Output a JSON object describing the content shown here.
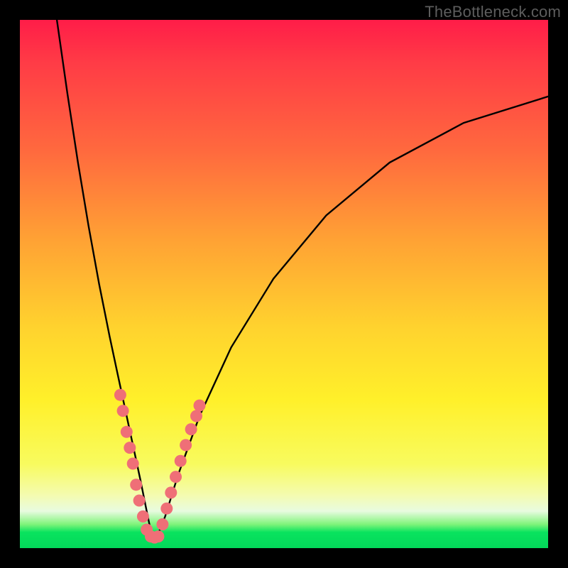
{
  "watermark": "TheBottleneck.com",
  "chart_data": {
    "type": "line",
    "title": "",
    "xlabel": "",
    "ylabel": "",
    "xlim": [
      0,
      100
    ],
    "ylim": [
      0,
      100
    ],
    "series": [
      {
        "name": "curve",
        "x": [
          7,
          9,
          11,
          13,
          15,
          17,
          18.5,
          20,
          21.5,
          22.8,
          24,
          25,
          26,
          27.5,
          30,
          34,
          40,
          48,
          58,
          70,
          84,
          100
        ],
        "y": [
          100,
          86,
          73,
          61,
          50,
          40,
          33,
          26,
          19,
          13,
          7,
          2.2,
          2.2,
          6,
          14,
          25,
          38,
          51,
          63,
          73,
          80.5,
          85.5
        ]
      }
    ],
    "markers": [
      {
        "cluster": "left-upper",
        "points": [
          {
            "x": 19.0,
            "y": 29
          },
          {
            "x": 19.5,
            "y": 26
          },
          {
            "x": 20.2,
            "y": 22
          },
          {
            "x": 20.8,
            "y": 19
          },
          {
            "x": 21.4,
            "y": 16
          }
        ]
      },
      {
        "cluster": "left-lower",
        "points": [
          {
            "x": 22.0,
            "y": 12
          },
          {
            "x": 22.6,
            "y": 9
          },
          {
            "x": 23.3,
            "y": 6
          },
          {
            "x": 24.0,
            "y": 3.5
          }
        ]
      },
      {
        "cluster": "trough",
        "points": [
          {
            "x": 24.8,
            "y": 2.2
          },
          {
            "x": 25.5,
            "y": 2.0
          },
          {
            "x": 26.2,
            "y": 2.2
          }
        ]
      },
      {
        "cluster": "right-lower",
        "points": [
          {
            "x": 27.0,
            "y": 4.5
          },
          {
            "x": 27.8,
            "y": 7.5
          },
          {
            "x": 28.6,
            "y": 10.5
          },
          {
            "x": 29.5,
            "y": 13.5
          },
          {
            "x": 30.4,
            "y": 16.5
          }
        ]
      },
      {
        "cluster": "right-upper",
        "points": [
          {
            "x": 31.4,
            "y": 19.5
          },
          {
            "x": 32.4,
            "y": 22.5
          },
          {
            "x": 33.4,
            "y": 25
          },
          {
            "x": 34.0,
            "y": 27
          }
        ]
      }
    ],
    "colors": {
      "curve": "#000000",
      "marker": "#ef6f77"
    }
  }
}
